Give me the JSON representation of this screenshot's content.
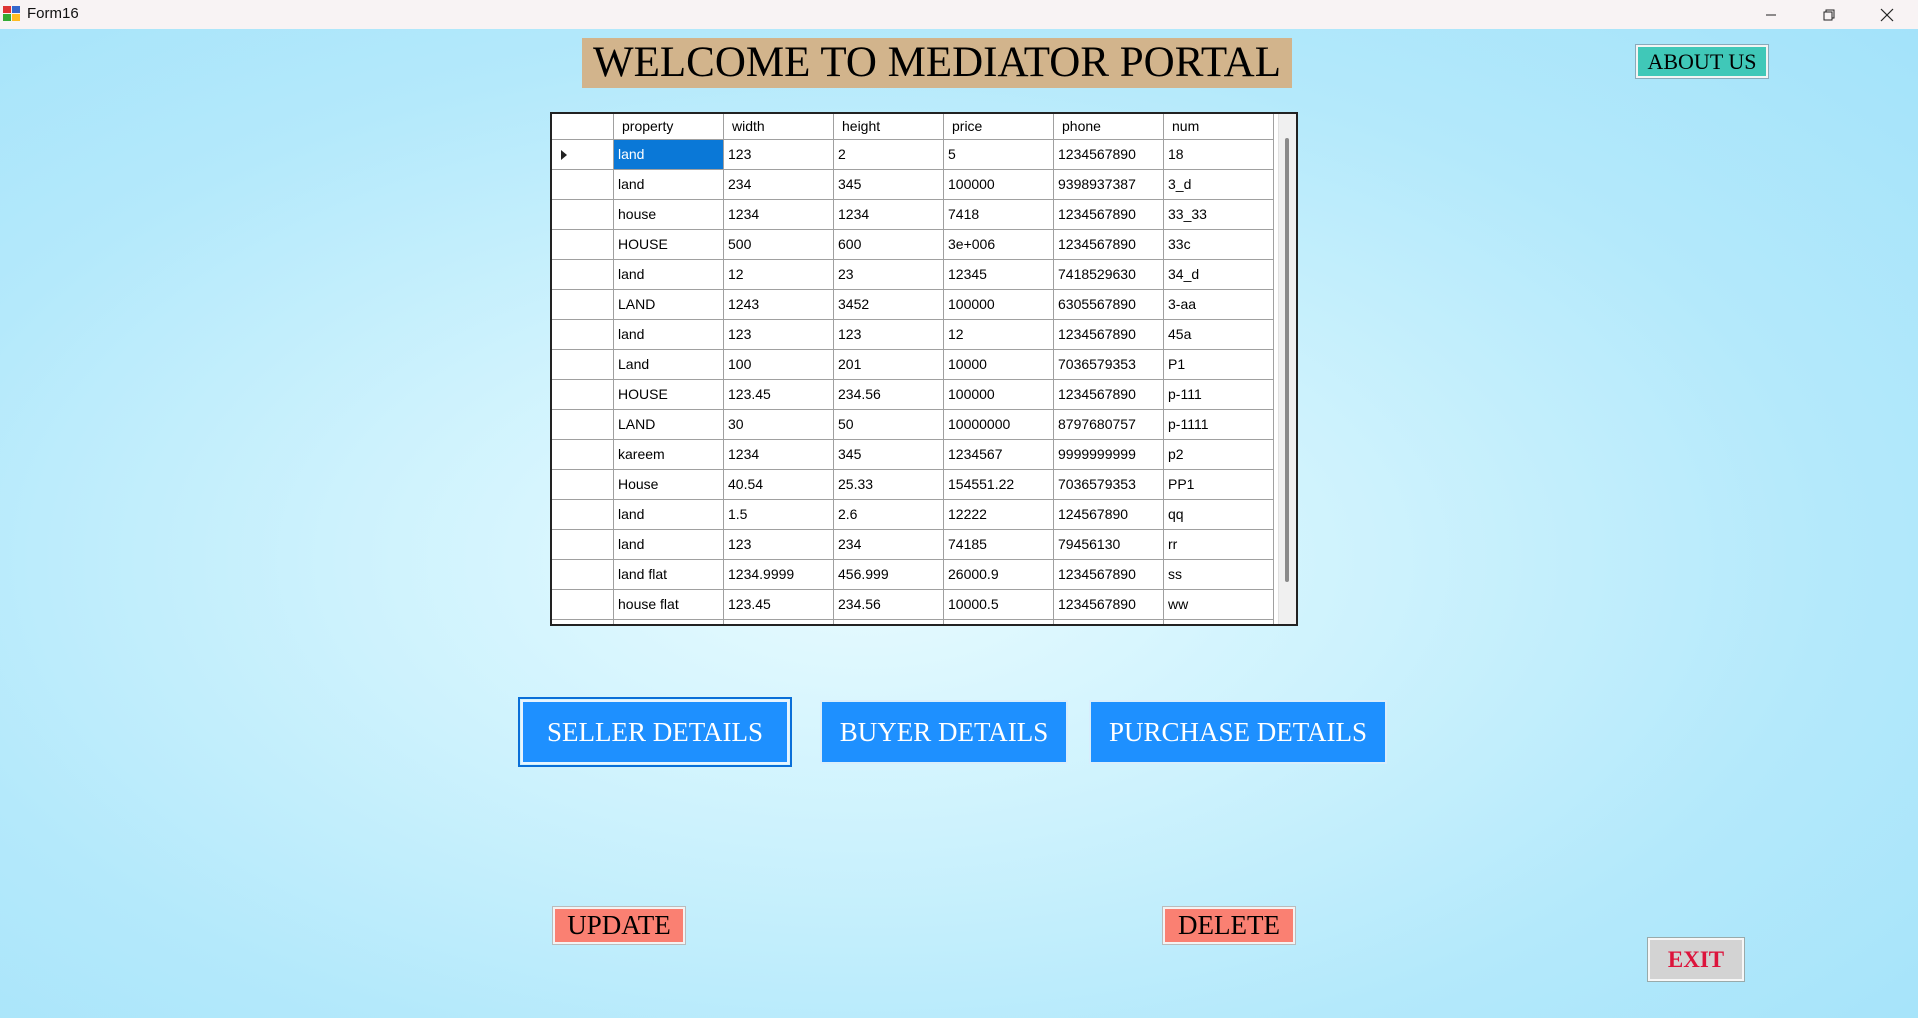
{
  "window": {
    "title": "Form16"
  },
  "header": {
    "welcome": "WELCOME TO MEDIATOR PORTAL",
    "about_label": "ABOUT US"
  },
  "grid": {
    "columns": [
      "property",
      "width",
      "height",
      "price",
      "phone",
      "num"
    ],
    "selected_row": 0,
    "selected_column": 0,
    "rows": [
      [
        "land",
        "123",
        "2",
        "5",
        "1234567890",
        "18"
      ],
      [
        "land",
        "234",
        "345",
        "100000",
        "9398937387",
        "3_d"
      ],
      [
        "house",
        "1234",
        "1234",
        "7418",
        "1234567890",
        "33_33"
      ],
      [
        "HOUSE",
        "500",
        "600",
        "3e+006",
        "1234567890",
        "33c"
      ],
      [
        "land",
        "12",
        "23",
        "12345",
        "7418529630",
        "34_d"
      ],
      [
        "LAND",
        "1243",
        "3452",
        "100000",
        "6305567890",
        "3-aa"
      ],
      [
        "land",
        "123",
        "123",
        "12",
        "1234567890",
        "45a"
      ],
      [
        "Land",
        "100",
        "201",
        "10000",
        "7036579353",
        "P1"
      ],
      [
        "HOUSE",
        "123.45",
        "234.56",
        "100000",
        "1234567890",
        "p-111"
      ],
      [
        "LAND",
        "30",
        "50",
        "10000000",
        "8797680757",
        "p-1111"
      ],
      [
        "kareem",
        "1234",
        "345",
        "1234567",
        "9999999999",
        "p2"
      ],
      [
        "House",
        "40.54",
        "25.33",
        "154551.22",
        "7036579353",
        "PP1"
      ],
      [
        "land",
        "1.5",
        "2.6",
        "12222",
        "124567890",
        "qq"
      ],
      [
        "land",
        "123",
        "234",
        "74185",
        "79456130",
        "rr"
      ],
      [
        "land flat",
        "1234.9999",
        "456.999",
        "26000.9",
        "1234567890",
        "ss"
      ],
      [
        "house flat",
        "123.45",
        "234.56",
        "10000.5",
        "1234567890",
        "ww"
      ]
    ]
  },
  "nav": {
    "seller_label": "SELLER DETAILS",
    "buyer_label": "BUYER DETAILS",
    "purchase_label": "PURCHASE DETAILS"
  },
  "actions": {
    "update_label": "UPDATE",
    "delete_label": "DELETE",
    "exit_label": "EXIT"
  },
  "colors": {
    "welcome_bg": "#d2b48c",
    "about_bg": "#40c8b8",
    "nav_bg": "#1e90ff",
    "action_bg": "#fa8072",
    "exit_text": "#dc143c",
    "selection": "#0a78d7"
  },
  "icons": {
    "app": "app-icon",
    "minimize": "minimize-icon",
    "maximize": "restore-icon",
    "close": "close-icon",
    "row_pointer": "current-row-arrow-icon"
  }
}
